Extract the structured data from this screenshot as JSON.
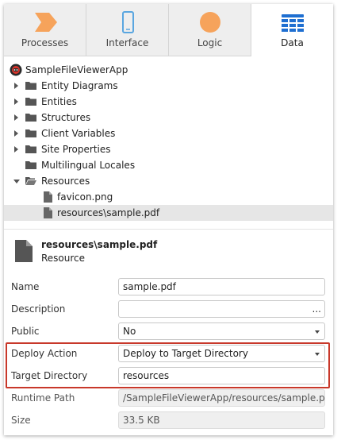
{
  "tabs": [
    {
      "label": "Processes",
      "icon": "process-chevron-icon",
      "active": false
    },
    {
      "label": "Interface",
      "icon": "mobile-device-icon",
      "active": false
    },
    {
      "label": "Logic",
      "icon": "logic-circle-icon",
      "active": false
    },
    {
      "label": "Data",
      "icon": "data-grid-icon",
      "active": true
    }
  ],
  "colors": {
    "accent_orange": "#f6a35b",
    "interface_blue": "#5aa6e0",
    "data_blue": "#1f6fd1",
    "highlight_red": "#c8382a"
  },
  "tree": {
    "root": "SampleFileViewerApp",
    "items": [
      {
        "label": "Entity Diagrams"
      },
      {
        "label": "Entities"
      },
      {
        "label": "Structures"
      },
      {
        "label": "Client Variables"
      },
      {
        "label": "Site Properties"
      },
      {
        "label": "Multilingual Locales"
      },
      {
        "label": "Resources"
      }
    ],
    "resources_children": [
      {
        "label": "favicon.png"
      },
      {
        "label": "resources\\sample.pdf"
      }
    ]
  },
  "info": {
    "name": "resources\\sample.pdf",
    "type": "Resource"
  },
  "properties": {
    "name": {
      "label": "Name",
      "value": "sample.pdf"
    },
    "description": {
      "label": "Description",
      "value": "",
      "ellipsis": "..."
    },
    "public": {
      "label": "Public",
      "value": "No"
    },
    "deploy_action": {
      "label": "Deploy Action",
      "value": "Deploy to Target Directory"
    },
    "target_directory": {
      "label": "Target Directory",
      "value": "resources"
    },
    "runtime_path": {
      "label": "Runtime Path",
      "value": "/SampleFileViewerApp/resources/sample.pdf"
    },
    "size": {
      "label": "Size",
      "value": "33.5 KB"
    }
  }
}
